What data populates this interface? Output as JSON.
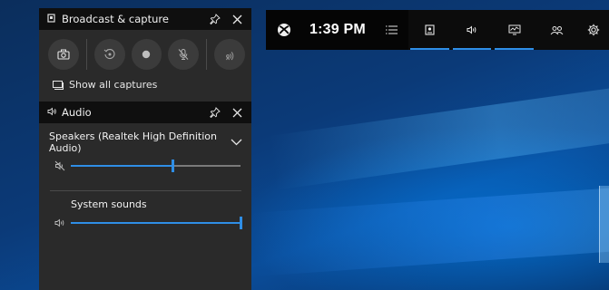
{
  "gamebar": {
    "time": "1:39 PM",
    "widgets": [
      {
        "icon": "broadcast-capture-widget-icon",
        "active": true
      },
      {
        "icon": "audio-widget-icon",
        "active": true
      },
      {
        "icon": "performance-widget-icon",
        "active": true
      },
      {
        "icon": "xbox-social-widget-icon",
        "active": false
      }
    ]
  },
  "capture": {
    "title": "Broadcast & capture",
    "show_all_label": "Show all captures",
    "buttons": [
      "screenshot",
      "record-last-30s",
      "start-recording",
      "microphone-off",
      "broadcast"
    ]
  },
  "audio": {
    "title": "Audio",
    "device_name": "Speakers (Realtek High Definition Audio)",
    "device_volume": 0.6,
    "apps": [
      {
        "label": "System sounds",
        "volume": 1.0
      }
    ]
  },
  "colors": {
    "accent": "#2f8ee6",
    "panel_bg": "#2a2a2a",
    "header_bg": "#0f0f0f",
    "bar_bg": "#0c0c0c"
  }
}
